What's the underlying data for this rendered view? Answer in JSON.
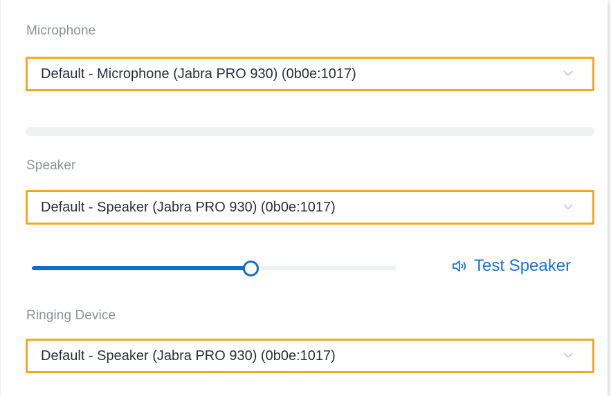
{
  "microphone": {
    "label": "Microphone",
    "selected": "Default - Microphone (Jabra PRO 930) (0b0e:1017)",
    "input_level": 0
  },
  "speaker": {
    "label": "Speaker",
    "selected": "Default - Speaker (Jabra PRO 930) (0b0e:1017)",
    "volume_percent": 60,
    "test_label": "Test Speaker",
    "test_icon": "speaker-volume-icon"
  },
  "ringing": {
    "label": "Ringing Device",
    "selected": "Default - Speaker (Jabra PRO 930) (0b0e:1017)"
  },
  "colors": {
    "highlight": "#f5a623",
    "accent": "#1a73d0",
    "label": "#8d9299"
  }
}
